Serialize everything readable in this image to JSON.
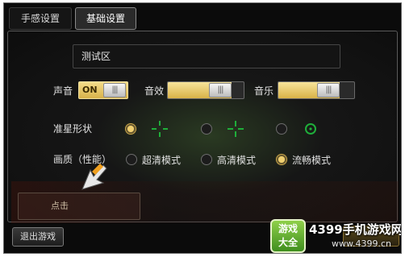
{
  "tabs": [
    {
      "label": "手感设置",
      "active": false
    },
    {
      "label": "基础设置",
      "active": true
    }
  ],
  "test_area": {
    "label": "测试区"
  },
  "audio": {
    "sound_label": "声音",
    "sound_toggle": "ON",
    "effects_label": "音效",
    "effects_level": 0.8,
    "music_label": "音乐",
    "music_level": 0.75,
    "grip_glyph": "|||"
  },
  "crosshair": {
    "label": "准星形状",
    "options": [
      {
        "icon": "crosshair-dashed-icon",
        "selected": true
      },
      {
        "icon": "crosshair-plus-icon",
        "selected": false
      },
      {
        "icon": "crosshair-circle-dot-icon",
        "selected": false
      }
    ],
    "color": "#1fae3a"
  },
  "quality": {
    "label": "画质（性能）",
    "options": [
      {
        "label": "超清模式",
        "selected": false
      },
      {
        "label": "高清模式",
        "selected": false
      },
      {
        "label": "流畅模式",
        "selected": true
      }
    ]
  },
  "click_button": {
    "label": "点击"
  },
  "exit_button": {
    "label": "退出游戏"
  },
  "watermark": {
    "logo_line1": "游戏",
    "logo_line2": "大全",
    "brand": "4399手机游戏网",
    "url": "www.4399.cn"
  },
  "colors": {
    "accent_gold": "#f0d071",
    "crosshair_green": "#1fae3a"
  }
}
